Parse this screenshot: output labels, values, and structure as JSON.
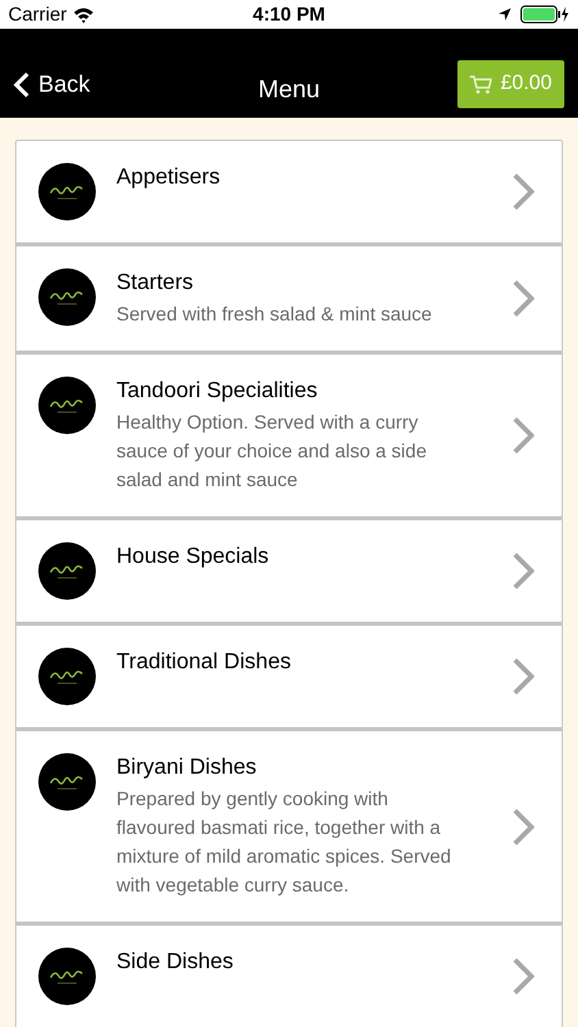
{
  "status_bar": {
    "carrier": "Carrier",
    "time": "4:10 PM"
  },
  "nav": {
    "back": "Back",
    "title": "Menu",
    "cart": "£0.00"
  },
  "items": [
    {
      "title": "Appetisers"
    },
    {
      "title": "Starters",
      "description": "Served with fresh salad & mint sauce"
    },
    {
      "title": "Tandoori Specialities",
      "description": "Healthy Option. Served with a curry sauce of your choice and also a side salad and mint sauce"
    },
    {
      "title": "House Specials"
    },
    {
      "title": "Traditional Dishes"
    },
    {
      "title": "Biryani Dishes",
      "description": "Prepared by gently cooking with flavoured basmati rice, together with a mixture of mild aromatic spices. Served with vegetable curry sauce."
    },
    {
      "title": "Side Dishes"
    }
  ]
}
